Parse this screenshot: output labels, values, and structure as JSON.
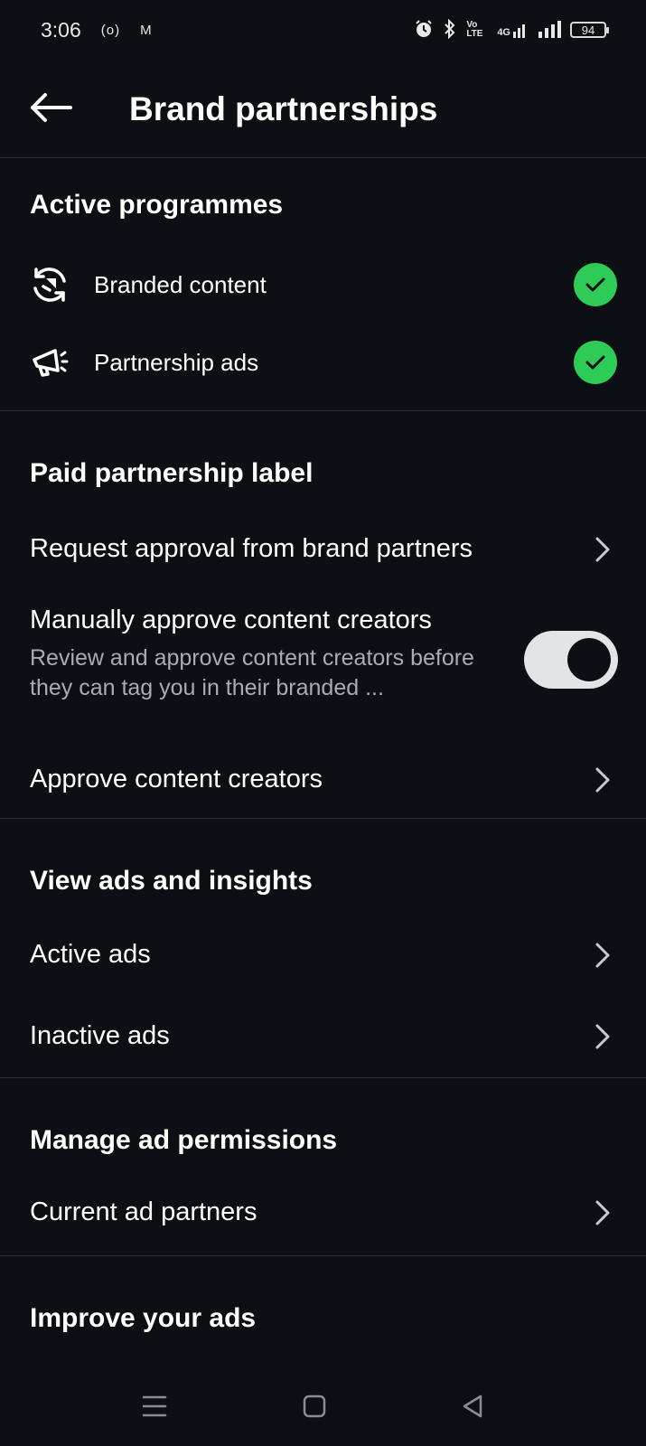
{
  "status_bar": {
    "time": "3:06",
    "left_icons": [
      "(o)",
      "M"
    ],
    "right_icons": [
      "alarm-icon",
      "bluetooth-icon",
      "volte-icon",
      "4g-signal-icon",
      "signal-icon"
    ],
    "volte_text": "Vo LTE",
    "network_text": "4G",
    "battery": "94"
  },
  "header": {
    "title": "Brand partnerships",
    "back_icon": "arrow-left-icon"
  },
  "sections": {
    "active_programmes": {
      "title": "Active programmes",
      "items": [
        {
          "label": "Branded content",
          "icon": "branded-content-icon",
          "status": "active"
        },
        {
          "label": "Partnership ads",
          "icon": "megaphone-icon",
          "status": "active"
        }
      ]
    },
    "paid_partnership": {
      "title": "Paid partnership label",
      "request_approval": "Request approval from brand partners",
      "manually_approve": {
        "label": "Manually approve content creators",
        "subtext": "Review and approve content creators before they can tag you in their branded ...",
        "enabled": true
      },
      "approve_creators": "Approve content creators"
    },
    "view_ads": {
      "title": "View ads and insights",
      "active_ads": "Active ads",
      "inactive_ads": "Inactive ads"
    },
    "ad_permissions": {
      "title": "Manage ad permissions",
      "current_partners": "Current ad partners"
    },
    "improve_ads": {
      "title": "Improve your ads"
    }
  },
  "colors": {
    "background": "#0c1014",
    "check_green": "#2ecc57",
    "toggle_track": "#e2e4e8",
    "subtext": "#a8adb3",
    "divider": "#2a2f35"
  }
}
